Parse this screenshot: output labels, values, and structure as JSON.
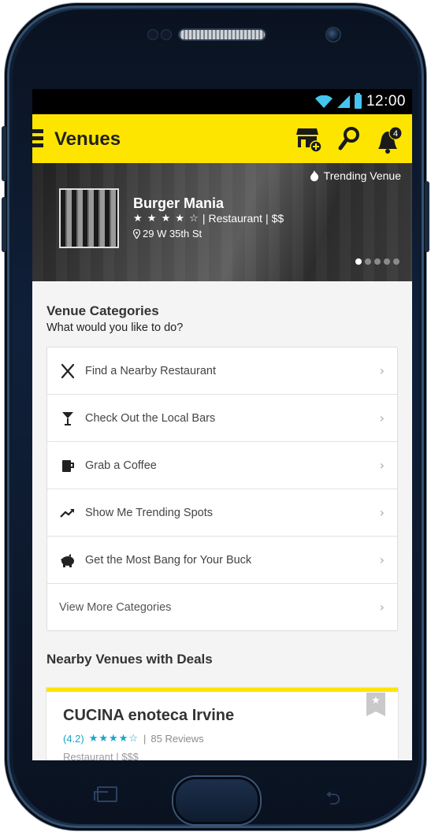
{
  "status_bar": {
    "time": "12:00"
  },
  "app_bar": {
    "title": "Venues",
    "notification_count": "4"
  },
  "hero": {
    "trending_label": "Trending Venue",
    "venue_name": "Burger Mania",
    "stars": "★ ★ ★ ★ ☆",
    "rating": 4,
    "separator": "|",
    "category": "Restaurant",
    "price": "$$",
    "address": "29 W 35th St",
    "carousel_total": 5,
    "carousel_active": 1
  },
  "categories": {
    "title": "Venue Categories",
    "subtitle": "What would you like to do?",
    "items": [
      {
        "label": "Find a Nearby Restaurant",
        "icon": "utensils-icon"
      },
      {
        "label": "Check Out the Local Bars",
        "icon": "cocktail-icon"
      },
      {
        "label": "Grab a Coffee",
        "icon": "coffee-icon"
      },
      {
        "label": "Show Me Trending Spots",
        "icon": "trending-icon"
      },
      {
        "label": "Get the Most Bang for Your Buck",
        "icon": "piggy-bank-icon"
      }
    ],
    "more_label": "View More Categories",
    "chevron": "›"
  },
  "deals": {
    "title": "Nearby Venues with Deals",
    "card": {
      "name": "CUCINA enoteca Irvine",
      "score": "(4.2)",
      "stars": "★★★★☆",
      "separator": "|",
      "reviews": "85 Reviews",
      "meta": "Restaurant  |  $$$"
    }
  },
  "colors": {
    "accent_yellow": "#fde500",
    "rating_teal": "#1aa6c7",
    "battery_blue": "#43c5f0"
  }
}
